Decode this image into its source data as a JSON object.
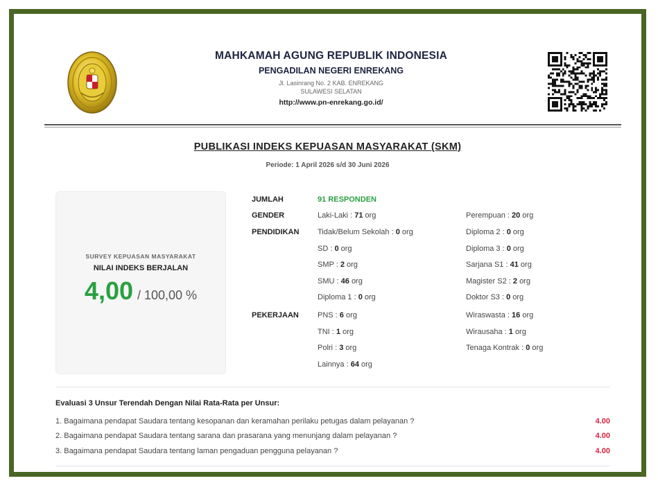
{
  "header": {
    "institution": "MAHKAMAH AGUNG REPUBLIK INDONESIA",
    "court": "PENGADILAN NEGERI ENREKANG",
    "address_line1": "Jl. Lasinrang No. 2 KAB. ENREKANG",
    "address_line2": "SULAWESI SELATAN",
    "url": "http://www.pn-enrekang.go.id/"
  },
  "title": "PUBLIKASI INDEKS KEPUASAN MASYARAKAT (SKM)",
  "period": "Periode: 1 April 2026 s/d 30 Juni 2026",
  "index_card": {
    "caption": "SURVEY KEPUASAN MASYARAKAT",
    "label": "NILAI INDEKS BERJALAN",
    "value": "4,00",
    "scale": "/ 100,00 %"
  },
  "stats": {
    "jumlah_label": "JUMLAH",
    "jumlah_value": "91 RESPONDEN",
    "gender_label": "GENDER",
    "pendidikan_label": "PENDIDIKAN",
    "pekerjaan_label": "PEKERJAAN",
    "unit": "org",
    "gender": [
      {
        "label": "Laki-Laki",
        "value": "71"
      },
      {
        "label": "Perempuan",
        "value": "20"
      }
    ],
    "pendidikan_left": [
      {
        "label": "Tidak/Belum Sekolah",
        "value": "0"
      },
      {
        "label": "SD",
        "value": "0"
      },
      {
        "label": "SMP",
        "value": "2"
      },
      {
        "label": "SMU",
        "value": "46"
      },
      {
        "label": "Diploma 1",
        "value": "0"
      }
    ],
    "pendidikan_right": [
      {
        "label": "Diploma 2",
        "value": "0"
      },
      {
        "label": "Diploma 3",
        "value": "0"
      },
      {
        "label": "Sarjana S1",
        "value": "41"
      },
      {
        "label": "Magister S2",
        "value": "2"
      },
      {
        "label": "Doktor S3",
        "value": "0"
      }
    ],
    "pekerjaan_left": [
      {
        "label": "PNS",
        "value": "6"
      },
      {
        "label": "TNI",
        "value": "1"
      },
      {
        "label": "Polri",
        "value": "3"
      },
      {
        "label": "Lainnya",
        "value": "64"
      }
    ],
    "pekerjaan_right": [
      {
        "label": "Wiraswasta",
        "value": "16"
      },
      {
        "label": "Wirausaha",
        "value": "1"
      },
      {
        "label": "Tenaga Kontrak",
        "value": "0"
      }
    ]
  },
  "evaluation": {
    "title": "Evaluasi 3 Unsur Terendah Dengan Nilai Rata-Rata per Unsur:",
    "items": [
      {
        "text": "1. Bagaimana pendapat Saudara tentang kesopanan dan keramahan perilaku petugas dalam pelayanan ?",
        "score": "4.00"
      },
      {
        "text": "2. Bagaimana pendapat Saudara tentang sarana dan prasarana yang menunjang dalam pelayanan ?",
        "score": "4.00"
      },
      {
        "text": "3. Bagaimana pendapat Saudara tentang laman pengaduan pengguna pelayanan ?",
        "score": "4.00"
      }
    ]
  },
  "colors": {
    "frame": "#4a6624",
    "index_value": "#2aa040",
    "score": "#d0263c"
  },
  "icons": {
    "logo": "mahkamah-agung-emblem",
    "qr": "qr-code"
  }
}
